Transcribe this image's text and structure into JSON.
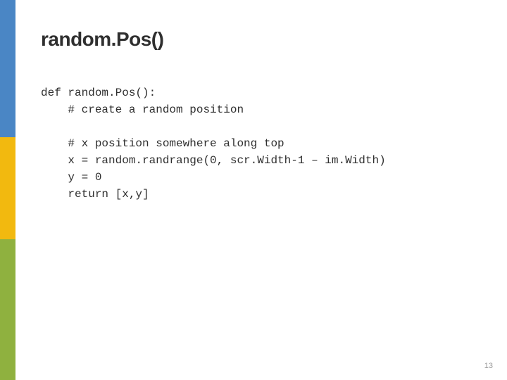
{
  "slide": {
    "title": "random.Pos()",
    "code": "def random.Pos():\n    # create a random position\n\n    # x position somewhere along top\n    x = random.randrange(0, scr.Width-1 – im.Width)\n    y = 0\n    return [x,y]",
    "page_number": "13"
  },
  "sidebar_colors": {
    "blue": "#4a86c5",
    "yellow": "#f2b90f",
    "green": "#8fb13f"
  }
}
